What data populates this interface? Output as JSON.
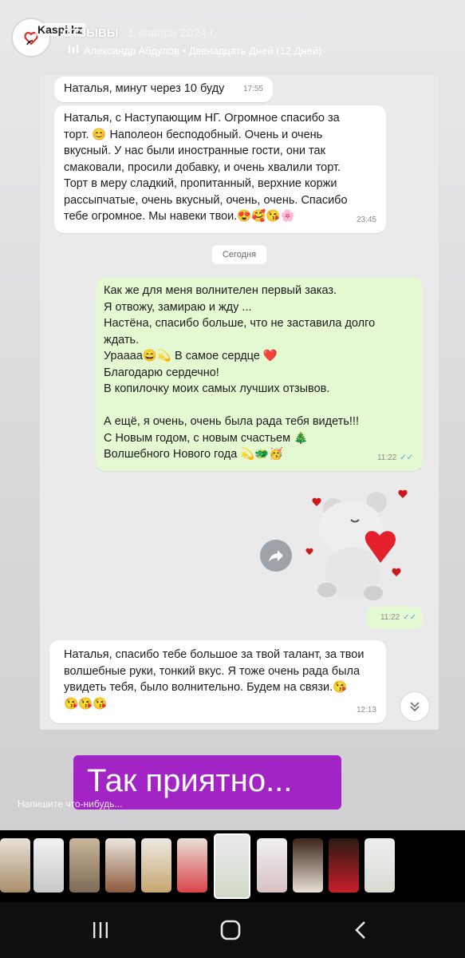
{
  "story": {
    "brand": "Kaspi.kz",
    "title": "ОТЗЫВЫ",
    "date": "1 января 2024 г.",
    "music": "Александр Абдулов • Двенадцать Дней (12 Дней)"
  },
  "chat": {
    "msg1": {
      "text": "Наталья, минут через 10 буду",
      "time": "17:55"
    },
    "msg2": {
      "text": "Наталья, с Наступающим НГ. Огромное спасибо за\nторт. 😊 Наполеон бесподобный.  Очень и очень\nвкусный. У нас были иностранные гости, они так\nсмаковали, просили добавку, и очень хвалили торт.\nТорт в меру сладкий, пропитанный, верхние коржи\nрассыпчатые, очень вкусный, очень, очень. Спасибо\nтебе огромное.  Мы навеки твои.😍🥰😘🌸",
      "time": "23:45"
    },
    "divider": "Сегодня",
    "msg3": {
      "text": "Как же для меня волнителен первый заказ.\nЯ отвожу, замираю и жду ...\nНастёна, спасибо больше, что не заставила долго\nждать.\nУраааа😄💫  В самое сердце ❤️\nБлагодарю сердечно!\nВ копилочку моих самых лучших отзывов.\n\nА ещё,  я очень, очень  была рада тебя видеть!!!\nС Новым годом, с новым счастьем 🎄\nВолшебного Нового года 💫🐲🥳",
      "time": "11:22"
    },
    "sticker_time": "11:22",
    "msg4": {
      "text": "Наталья, спасибо тебе большое за твой талант, за твои\nволшебные руки, тонкий вкус. Я тоже очень рада была\nувидеть тебя, было волнительно. Будем на связи.😘\n😘😘😘",
      "time": "12:13"
    }
  },
  "caption": "Так приятно...",
  "reply_placeholder": "Напишите что-нибудь...",
  "colors": {
    "caption_bg": "#a224c4",
    "outgoing_bubble": "#e4f8d2",
    "incoming_bubble": "#ffffff",
    "read_check": "#4fa8e3"
  },
  "icons": [
    "kaspi-logo-icon",
    "music-bars-icon",
    "forward-icon",
    "scroll-down-icon",
    "recent-apps-icon",
    "home-icon",
    "back-icon"
  ]
}
